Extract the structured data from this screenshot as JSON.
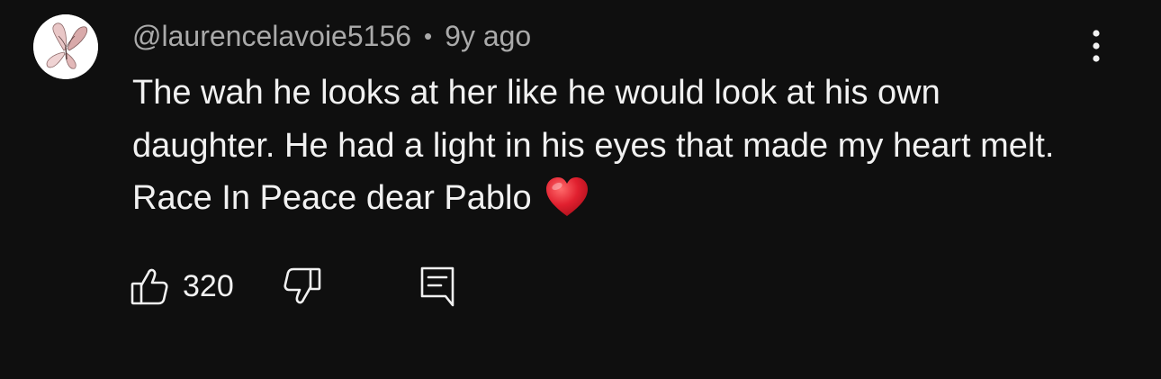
{
  "comment": {
    "author": "@laurencelavoie5156",
    "separator": "•",
    "time": "9y ago",
    "text": "The wah he looks at her like he would look at his own daughter. He had a light in his eyes that made my heart melt. Race In Peace dear Pablo",
    "emoji": "heart-emoji",
    "like_count": "320"
  },
  "icons": {
    "avatar": "butterfly-avatar",
    "menu": "more-vertical-icon",
    "like": "thumbs-up-icon",
    "dislike": "thumbs-down-icon",
    "reply": "comment-reply-icon"
  },
  "colors": {
    "background": "#0f0f0f",
    "text": "#f1f1f1",
    "secondary_text": "#aaaaaa",
    "heart": "#e1202f"
  }
}
